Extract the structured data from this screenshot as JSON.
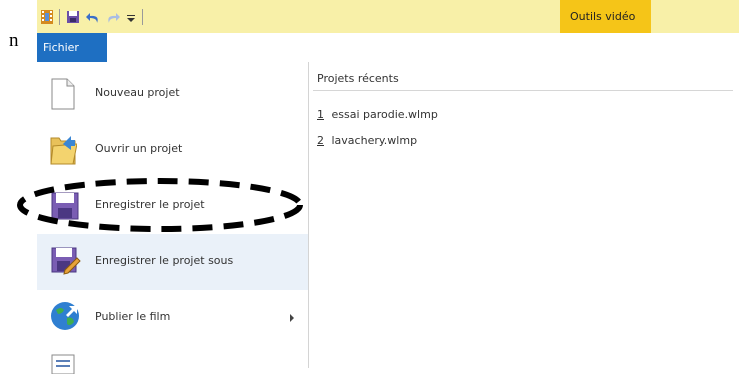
{
  "outside": {
    "text": "n"
  },
  "qat": {
    "icons": [
      "film-icon",
      "save-icon",
      "undo-icon",
      "redo-icon",
      "dropdown-icon"
    ]
  },
  "contextual_tab": {
    "label": "Outils vidéo"
  },
  "file_tab": {
    "label": "Fichier"
  },
  "menu": {
    "items": [
      {
        "label": "Nouveau projet",
        "icon": "new-document-icon"
      },
      {
        "label": "Ouvrir un projet",
        "icon": "open-folder-icon"
      },
      {
        "label": "Enregistrer le projet",
        "icon": "save-icon"
      },
      {
        "label": "Enregistrer le projet sous",
        "icon": "save-as-icon"
      },
      {
        "label": "Publier le film",
        "icon": "globe-publish-icon"
      }
    ]
  },
  "recent": {
    "title": "Projets récents",
    "items": [
      {
        "number": "1",
        "name": "essai parodie.wlmp"
      },
      {
        "number": "2",
        "name": "lavachery.wlmp"
      }
    ]
  },
  "colors": {
    "qat_bg": "#f8f0a8",
    "contextual_tab": "#f5c518",
    "file_tab": "#1e6fc2",
    "highlight": "#eaf1f9"
  }
}
